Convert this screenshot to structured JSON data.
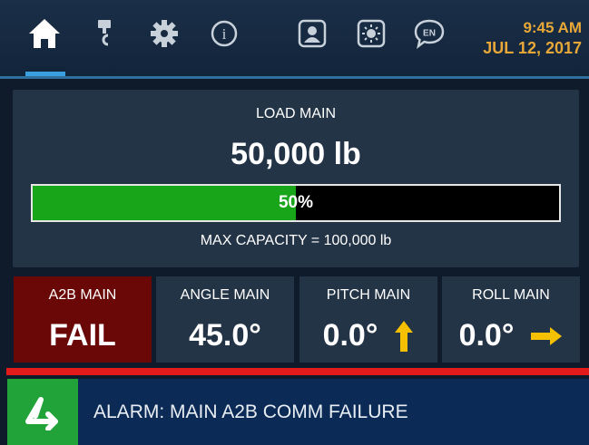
{
  "header": {
    "time": "9:45 AM",
    "date": "JUL 12, 2017",
    "language_code": "EN",
    "info_glyph": "i",
    "nav_items": [
      "home-icon",
      "crane-hook-icon",
      "gear-icon",
      "info-icon",
      "operator-profile-icon",
      "brightness-icon",
      "language-icon"
    ]
  },
  "load": {
    "title": "LOAD MAIN",
    "value": "50,000 lb",
    "percent_label": "50%",
    "percent": 0.5,
    "max_capacity": "MAX CAPACITY = 100,000 lb",
    "bar_color": "#19a519"
  },
  "tiles": [
    {
      "label": "A2B MAIN",
      "value": "FAIL",
      "status_color": "#6a0808"
    },
    {
      "label": "ANGLE MAIN",
      "value": "45.0°"
    },
    {
      "label": "PITCH MAIN",
      "value": "0.0°",
      "arrow": "up-arrow-icon"
    },
    {
      "label": "ROLL MAIN",
      "value": "0.0°",
      "arrow": "right-arrow-icon"
    }
  ],
  "alarm": {
    "text": "ALARM: MAIN A2B COMM FAILURE",
    "icon": "acknowledge-arrow-icon"
  },
  "colors": {
    "accent_orange": "#e8a838",
    "arrow_yellow": "#f5c000",
    "alarm_red": "#e41b1b",
    "alarm_green": "#22a33a"
  }
}
